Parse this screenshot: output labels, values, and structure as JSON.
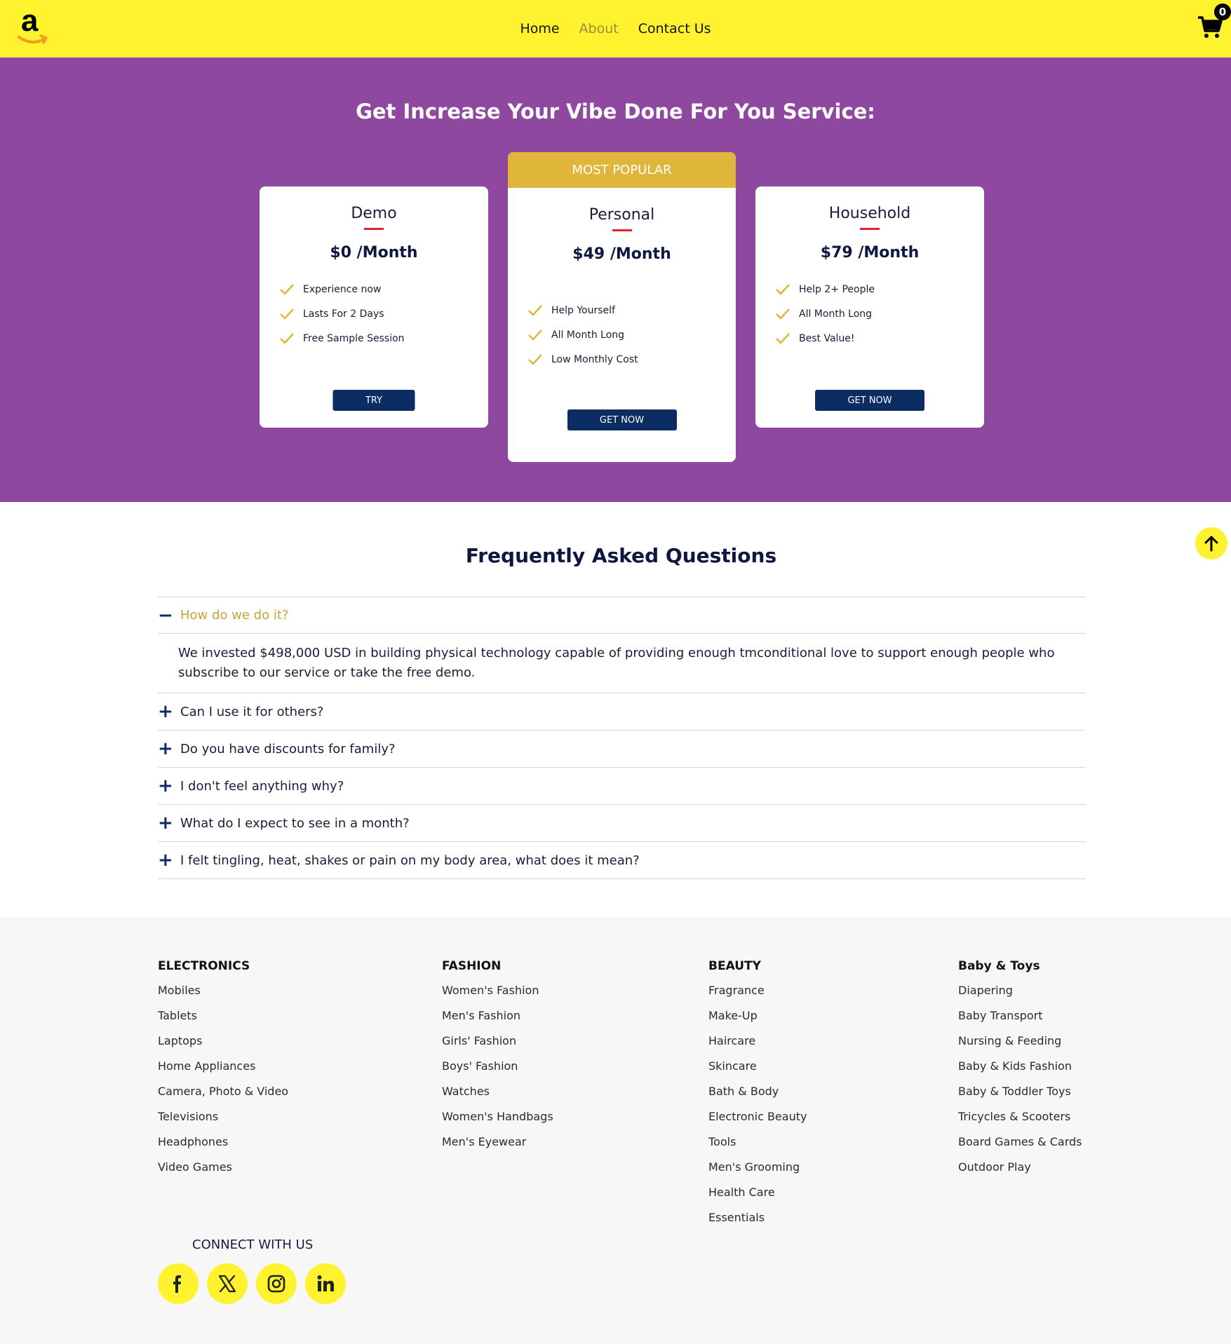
{
  "header": {
    "logo_letter": "a",
    "nav": [
      "Home",
      "About",
      "Contact Us"
    ],
    "active_nav": "About",
    "cart_count": "0"
  },
  "pricing": {
    "title": "Get Increase Your Vibe Done For You Service:",
    "plans": [
      {
        "name": "Demo",
        "price": "$0 /Month",
        "features": [
          "Experience now",
          "Lasts For 2 Days",
          "Free Sample Session"
        ],
        "button": "TRY"
      },
      {
        "badge": "MOST POPULAR",
        "name": "Personal",
        "price": "$49 /Month",
        "features": [
          "Help Yourself",
          "All Month Long",
          "Low Monthly Cost"
        ],
        "button": "GET NOW"
      },
      {
        "name": "Household",
        "price": "$79 /Month",
        "features": [
          "Help 2+ People",
          "All Month Long",
          "Best Value!"
        ],
        "button": "GET NOW"
      }
    ]
  },
  "faq": {
    "title": "Frequently Asked Questions",
    "items": [
      {
        "question": "How do we do it?",
        "answer": "We invested $498,000 USD in building physical technology capable of providing enough tmconditional love to support enough people who subscribe to our service or take the free demo.",
        "sign": "−"
      },
      {
        "question": "Can I use it for others?",
        "sign": "+"
      },
      {
        "question": "Do you have discounts for family?",
        "sign": "+"
      },
      {
        "question": "I don't feel anything why?",
        "sign": "+"
      },
      {
        "question": "What do I expect to see in a month?",
        "sign": "+"
      },
      {
        "question": "I felt tingling, heat, shakes or pain on my body area, what does it mean?",
        "sign": "+"
      }
    ]
  },
  "footer": {
    "columns": [
      {
        "heading": "ELECTRONICS",
        "links": [
          "Mobiles",
          "Tablets",
          "Laptops",
          "Home Appliances",
          "Camera, Photo & Video",
          "Televisions",
          "Headphones",
          "Video Games"
        ]
      },
      {
        "heading": "FASHION",
        "links": [
          "Women's Fashion",
          "Men's Fashion",
          "Girls' Fashion",
          "Boys' Fashion",
          "Watches",
          "Women's Handbags",
          "Men's Eyewear"
        ]
      },
      {
        "heading": "BEAUTY",
        "links": [
          "Fragrance",
          "Make-Up",
          "Haircare",
          "Skincare",
          "Bath & Body",
          "Electronic Beauty",
          "Tools",
          "Men's Grooming",
          "Health Care",
          "Essentials"
        ]
      },
      {
        "heading": "Baby & Toys",
        "links": [
          "Diapering",
          "Baby Transport",
          "Nursing & Feeding",
          "Baby & Kids Fashion",
          "Baby & Toddler Toys",
          "Tricycles & Scooters",
          "Board Games & Cards",
          "Outdoor Play"
        ]
      }
    ],
    "connect_label": "CONNECT WITH US",
    "socials": [
      "facebook-icon",
      "x-icon",
      "instagram-icon",
      "linkedin-icon"
    ]
  },
  "colors": {
    "header_bg": "#fff22e",
    "pricing_bg": "#8f48a0",
    "badge_gold": "#e0b63a",
    "button_navy": "#0b2d63",
    "underline_red": "#e0262d"
  }
}
